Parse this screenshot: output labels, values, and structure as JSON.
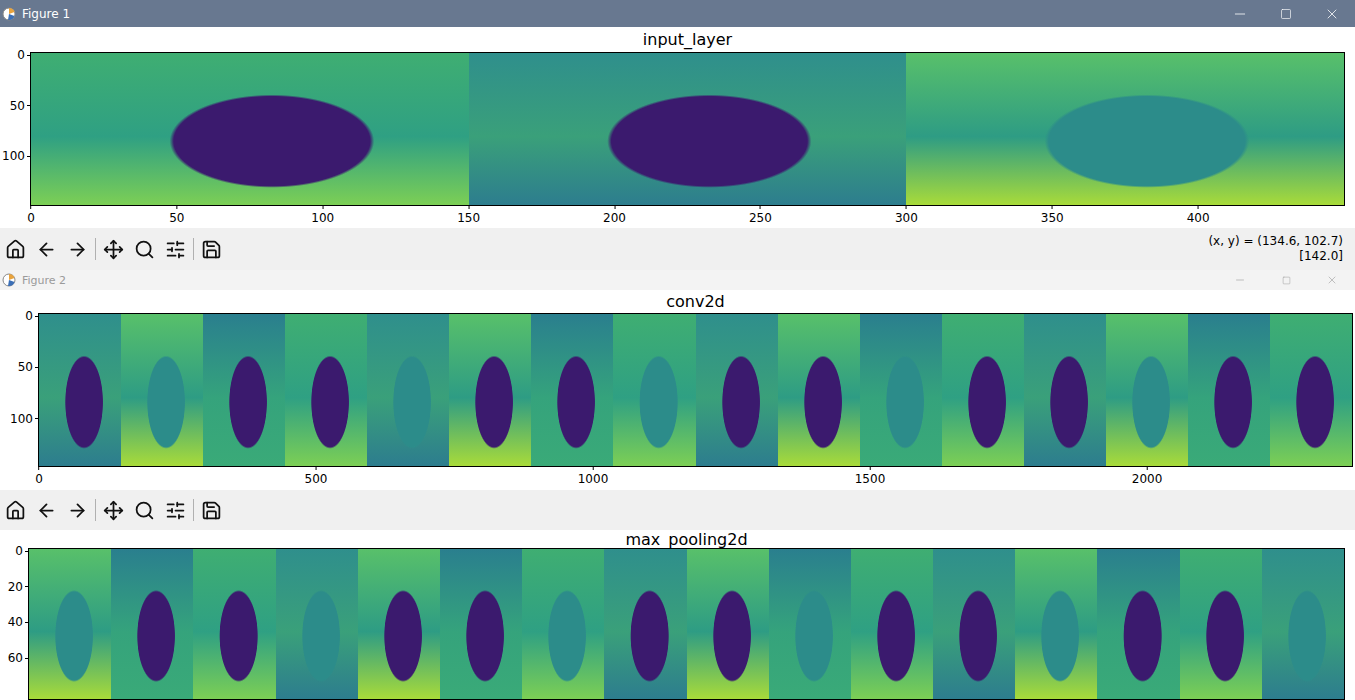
{
  "windows": [
    {
      "title": "Figure 1",
      "active": true,
      "plot": {
        "title": "input_layer",
        "tiles": 3,
        "x_max": 450,
        "y_max": 150,
        "x_ticks": [
          "0",
          "50",
          "100",
          "150",
          "200",
          "250",
          "300",
          "350",
          "400"
        ],
        "y_ticks": [
          "0",
          "50",
          "100"
        ]
      },
      "toolbar": {
        "readout": [
          "(x, y) = (134.6, 102.7)",
          "[142.0]"
        ]
      }
    },
    {
      "title": "Figure 2",
      "active": false,
      "plot": {
        "title": "conv2d",
        "tiles": 16,
        "x_max": 2370,
        "y_max": 148,
        "x_ticks": [
          "0",
          "500",
          "1000",
          "1500",
          "2000"
        ],
        "y_ticks": [
          "0",
          "50",
          "100"
        ]
      },
      "toolbar": {
        "readout": []
      }
    },
    {
      "active": false,
      "plot": {
        "title": "max_pooling2d",
        "tiles": 16,
        "x_max": 1184,
        "y_max": 84,
        "x_ticks": [],
        "y_ticks": [
          "0",
          "20",
          "40",
          "60"
        ]
      }
    }
  ]
}
